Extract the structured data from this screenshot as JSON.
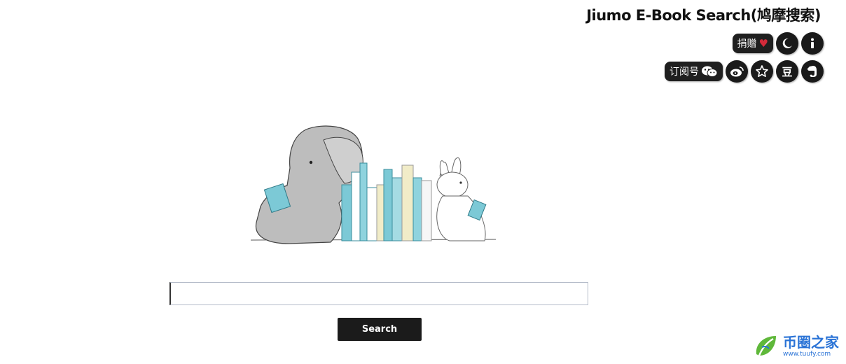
{
  "header": {
    "title": "Jiumo E-Book Search(鸠摩搜索)"
  },
  "toolbar": {
    "donate_label": "捐赠",
    "donate_heart": "♥",
    "subscribe_label": "订阅号",
    "douban_label": "豆",
    "icons": [
      "heart-icon",
      "moon-icon",
      "info-icon",
      "wechat-icon",
      "weibo-icon",
      "star-icon",
      "douban-icon",
      "evernote-icon"
    ]
  },
  "search": {
    "input_value": "",
    "placeholder": "",
    "button_label": "Search"
  },
  "watermark": {
    "name": "币圈之家",
    "url": "www.tuufy.com"
  },
  "colors": {
    "icon_bg": "#1a1a1a",
    "heart": "#d42a3a",
    "book_teal": "#7cc9d6",
    "book_cream": "#f1ecc8",
    "watermark_blue": "#2a73d6",
    "watermark_green": "#5fb83a"
  }
}
